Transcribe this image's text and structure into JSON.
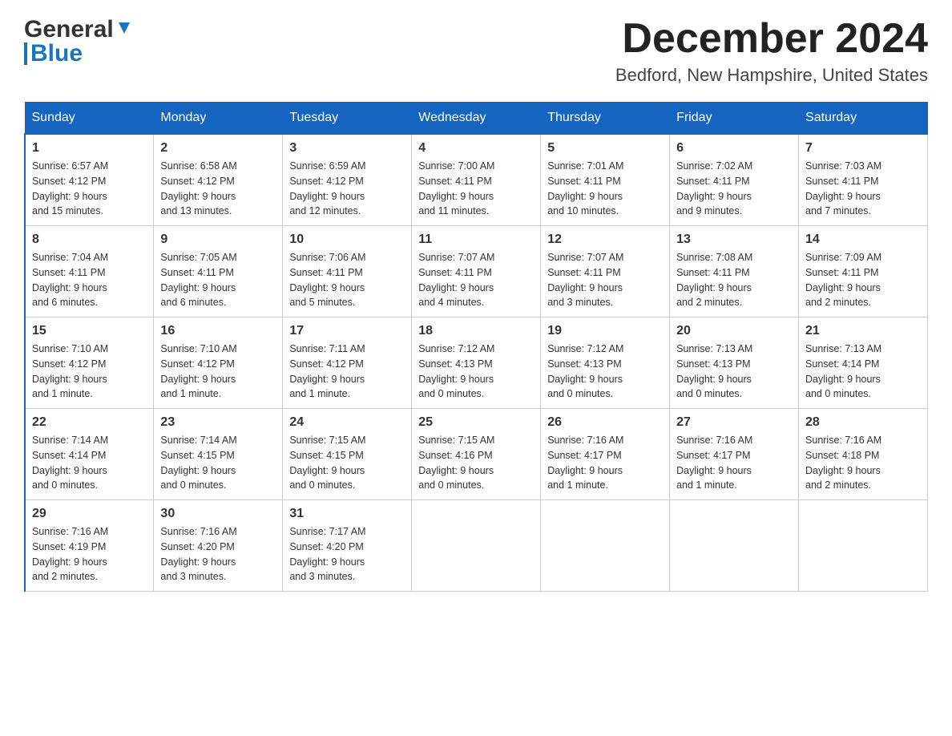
{
  "header": {
    "logo_general": "General",
    "logo_blue": "Blue",
    "month_title": "December 2024",
    "location": "Bedford, New Hampshire, United States"
  },
  "days_of_week": [
    "Sunday",
    "Monday",
    "Tuesday",
    "Wednesday",
    "Thursday",
    "Friday",
    "Saturday"
  ],
  "weeks": [
    [
      {
        "day": "1",
        "sunrise": "6:57 AM",
        "sunset": "4:12 PM",
        "daylight": "9 hours and 15 minutes."
      },
      {
        "day": "2",
        "sunrise": "6:58 AM",
        "sunset": "4:12 PM",
        "daylight": "9 hours and 13 minutes."
      },
      {
        "day": "3",
        "sunrise": "6:59 AM",
        "sunset": "4:12 PM",
        "daylight": "9 hours and 12 minutes."
      },
      {
        "day": "4",
        "sunrise": "7:00 AM",
        "sunset": "4:11 PM",
        "daylight": "9 hours and 11 minutes."
      },
      {
        "day": "5",
        "sunrise": "7:01 AM",
        "sunset": "4:11 PM",
        "daylight": "9 hours and 10 minutes."
      },
      {
        "day": "6",
        "sunrise": "7:02 AM",
        "sunset": "4:11 PM",
        "daylight": "9 hours and 9 minutes."
      },
      {
        "day": "7",
        "sunrise": "7:03 AM",
        "sunset": "4:11 PM",
        "daylight": "9 hours and 7 minutes."
      }
    ],
    [
      {
        "day": "8",
        "sunrise": "7:04 AM",
        "sunset": "4:11 PM",
        "daylight": "9 hours and 6 minutes."
      },
      {
        "day": "9",
        "sunrise": "7:05 AM",
        "sunset": "4:11 PM",
        "daylight": "9 hours and 6 minutes."
      },
      {
        "day": "10",
        "sunrise": "7:06 AM",
        "sunset": "4:11 PM",
        "daylight": "9 hours and 5 minutes."
      },
      {
        "day": "11",
        "sunrise": "7:07 AM",
        "sunset": "4:11 PM",
        "daylight": "9 hours and 4 minutes."
      },
      {
        "day": "12",
        "sunrise": "7:07 AM",
        "sunset": "4:11 PM",
        "daylight": "9 hours and 3 minutes."
      },
      {
        "day": "13",
        "sunrise": "7:08 AM",
        "sunset": "4:11 PM",
        "daylight": "9 hours and 2 minutes."
      },
      {
        "day": "14",
        "sunrise": "7:09 AM",
        "sunset": "4:11 PM",
        "daylight": "9 hours and 2 minutes."
      }
    ],
    [
      {
        "day": "15",
        "sunrise": "7:10 AM",
        "sunset": "4:12 PM",
        "daylight": "9 hours and 1 minute."
      },
      {
        "day": "16",
        "sunrise": "7:10 AM",
        "sunset": "4:12 PM",
        "daylight": "9 hours and 1 minute."
      },
      {
        "day": "17",
        "sunrise": "7:11 AM",
        "sunset": "4:12 PM",
        "daylight": "9 hours and 1 minute."
      },
      {
        "day": "18",
        "sunrise": "7:12 AM",
        "sunset": "4:13 PM",
        "daylight": "9 hours and 0 minutes."
      },
      {
        "day": "19",
        "sunrise": "7:12 AM",
        "sunset": "4:13 PM",
        "daylight": "9 hours and 0 minutes."
      },
      {
        "day": "20",
        "sunrise": "7:13 AM",
        "sunset": "4:13 PM",
        "daylight": "9 hours and 0 minutes."
      },
      {
        "day": "21",
        "sunrise": "7:13 AM",
        "sunset": "4:14 PM",
        "daylight": "9 hours and 0 minutes."
      }
    ],
    [
      {
        "day": "22",
        "sunrise": "7:14 AM",
        "sunset": "4:14 PM",
        "daylight": "9 hours and 0 minutes."
      },
      {
        "day": "23",
        "sunrise": "7:14 AM",
        "sunset": "4:15 PM",
        "daylight": "9 hours and 0 minutes."
      },
      {
        "day": "24",
        "sunrise": "7:15 AM",
        "sunset": "4:15 PM",
        "daylight": "9 hours and 0 minutes."
      },
      {
        "day": "25",
        "sunrise": "7:15 AM",
        "sunset": "4:16 PM",
        "daylight": "9 hours and 0 minutes."
      },
      {
        "day": "26",
        "sunrise": "7:16 AM",
        "sunset": "4:17 PM",
        "daylight": "9 hours and 1 minute."
      },
      {
        "day": "27",
        "sunrise": "7:16 AM",
        "sunset": "4:17 PM",
        "daylight": "9 hours and 1 minute."
      },
      {
        "day": "28",
        "sunrise": "7:16 AM",
        "sunset": "4:18 PM",
        "daylight": "9 hours and 2 minutes."
      }
    ],
    [
      {
        "day": "29",
        "sunrise": "7:16 AM",
        "sunset": "4:19 PM",
        "daylight": "9 hours and 2 minutes."
      },
      {
        "day": "30",
        "sunrise": "7:16 AM",
        "sunset": "4:20 PM",
        "daylight": "9 hours and 3 minutes."
      },
      {
        "day": "31",
        "sunrise": "7:17 AM",
        "sunset": "4:20 PM",
        "daylight": "9 hours and 3 minutes."
      },
      null,
      null,
      null,
      null
    ]
  ],
  "labels": {
    "sunrise": "Sunrise:",
    "sunset": "Sunset:",
    "daylight": "Daylight:"
  }
}
